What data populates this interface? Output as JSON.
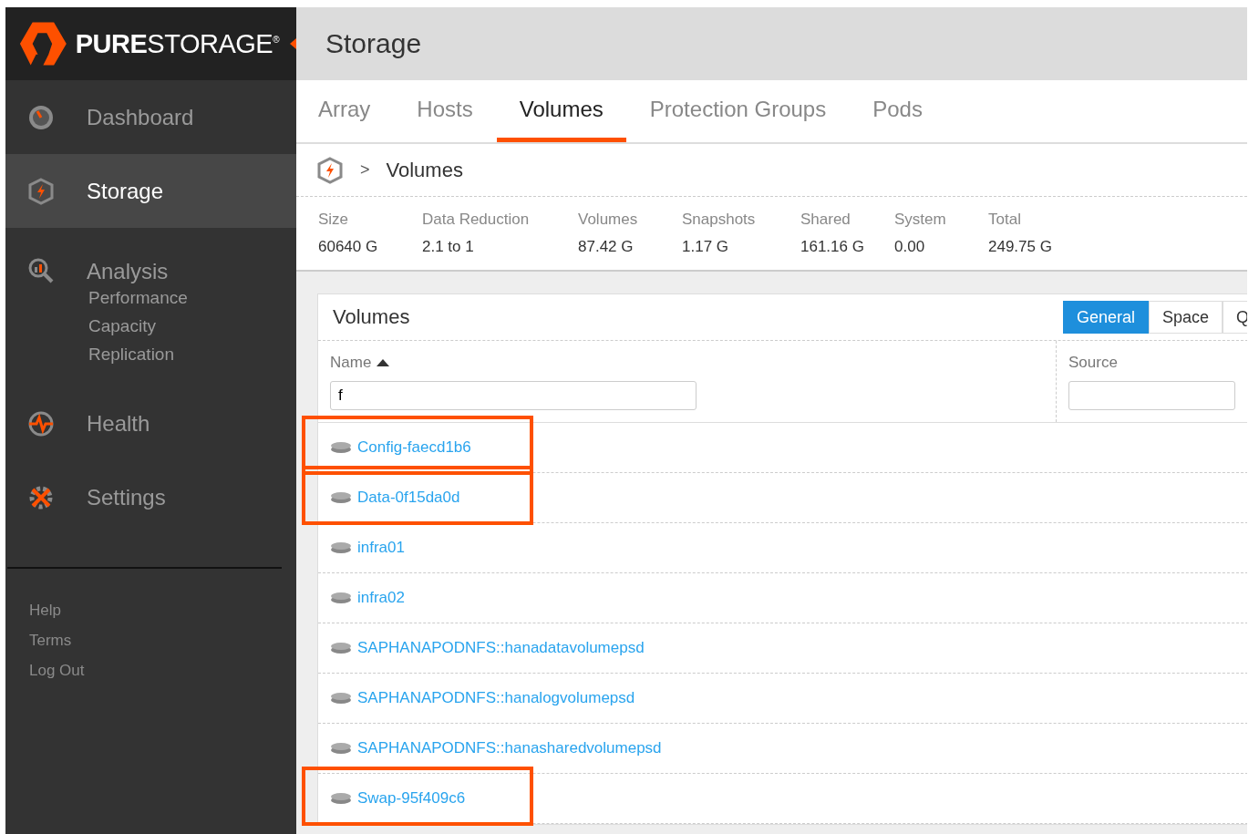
{
  "logo": {
    "text": "**PURE**STORAGE$^{®}$"
  },
  "sidebar": {
    "items": [
      {
        "label": "Dashboard",
        "kind": "gauge",
        "selected": false
      },
      {
        "label": "Storage",
        "kind": "storage",
        "selected": true
      },
      {
        "label": "Analysis",
        "kind": "analysis",
        "selected": false,
        "children": [
          {
            "label": "Performance"
          },
          {
            "label": "Capacity"
          },
          {
            "label": "Replication"
          }
        ]
      },
      {
        "label": "Health",
        "kind": "health",
        "selected": false
      },
      {
        "label": "Settings",
        "kind": "settings",
        "selected": false
      }
    ],
    "footer_links": [
      "Help",
      "Terms",
      "Log Out"
    ]
  },
  "page_title": "Storage",
  "tabs": [
    {
      "label": "Array",
      "selected": false
    },
    {
      "label": "Hosts",
      "selected": false
    },
    {
      "label": "Volumes",
      "selected": true
    },
    {
      "label": "Protection Groups",
      "selected": false
    },
    {
      "label": "Pods",
      "selected": false
    }
  ],
  "breadcrumb": {
    "separator": ">",
    "current": "Volumes"
  },
  "stats": [
    {
      "label": "Size",
      "value": "60640 G"
    },
    {
      "label": "Data Reduction",
      "value": "2.1 to 1"
    },
    {
      "label": "Volumes",
      "value": "87.42 G"
    },
    {
      "label": "Snapshots",
      "value": "1.17 G"
    },
    {
      "label": "Shared",
      "value": "161.16 G"
    },
    {
      "label": "System",
      "value": "0.00"
    },
    {
      "label": "Total",
      "value": "249.75 G"
    }
  ],
  "volumes_panel": {
    "title": "Volumes",
    "view_buttons": [
      {
        "label": "General",
        "selected": true
      },
      {
        "label": "Space",
        "selected": false
      },
      {
        "label": "Q",
        "selected": false
      }
    ],
    "columns": [
      {
        "label": "Name",
        "sort_ascending": true,
        "filter_value": "f"
      },
      {
        "label": "Source"
      }
    ],
    "rows": [
      {
        "name": "Config-faecd1b6",
        "highlighted": true
      },
      {
        "name": "Data-0f15da0d",
        "highlighted": true
      },
      {
        "name": "infra01",
        "highlighted": false
      },
      {
        "name": "infra02",
        "highlighted": false
      },
      {
        "name": "SAPHANAPODNFS::hanadatavolumepsd",
        "highlighted": false
      },
      {
        "name": "SAPHANAPODNFS::hanalogvolumepsd",
        "highlighted": false
      },
      {
        "name": "SAPHANAPODNFS::hanasharedvolumepsd",
        "highlighted": false
      },
      {
        "name": "Swap-95f409c6",
        "highlighted": true
      }
    ]
  }
}
